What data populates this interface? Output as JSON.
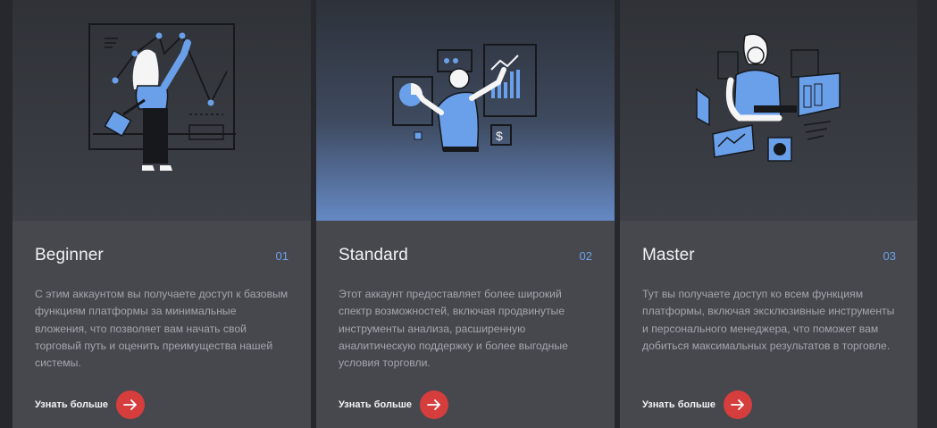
{
  "cards": [
    {
      "title": "Beginner",
      "number": "01",
      "description": "С этим аккаунтом вы получаете доступ к базовым функциям платформы за минимальные вложения, что позволяет вам начать свой торговый путь и оценить преимущества нашей системы.",
      "cta_label": "Узнать больше"
    },
    {
      "title": "Standard",
      "number": "02",
      "description": "Этот аккаунт предоставляет более широкий спектр возможностей, включая продвинутые инструменты анализа, расширенную аналитическую поддержку и более выгодные условия торговли.",
      "cta_label": "Узнать больше"
    },
    {
      "title": "Master",
      "number": "03",
      "description": "Тут вы получаете доступ ко всем функциям платформы, включая эксклюзивные инструменты и персонального менеджера, что поможет вам добиться максимальных результатов в торговле.",
      "cta_label": "Узнать больше"
    }
  ],
  "colors": {
    "accent_blue": "#6fa0e8",
    "cta_red": "#d63d3d",
    "card_bg": "#46484e"
  },
  "icons": [
    "arrow-right-icon"
  ]
}
